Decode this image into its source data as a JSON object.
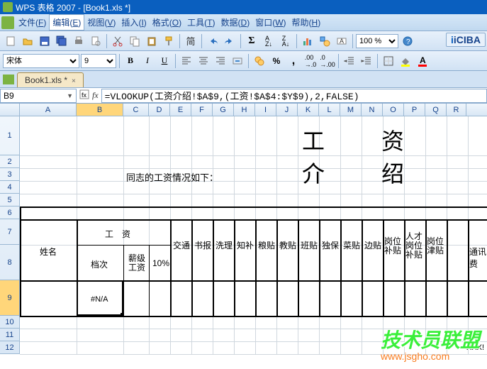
{
  "title": "WPS 表格 2007 - [Book1.xls *]",
  "menu": {
    "file": "文件",
    "fk": "F",
    "edit": "编辑",
    "ek": "E",
    "view": "视图",
    "vk": "V",
    "insert": "插入",
    "ik": "I",
    "format": "格式",
    "ok": "O",
    "tools": "工具",
    "tk": "T",
    "data": "数据",
    "dk": "D",
    "window": "窗口",
    "wk": "W",
    "help": "帮助",
    "hk": "H"
  },
  "fontname": "宋体",
  "fontsize": "9",
  "zoom": "100 %",
  "cjk": "简",
  "iciba": "iCIBA",
  "tab": {
    "name": "Book1.xls *",
    "close": "×"
  },
  "namebox": "B9",
  "formula": "=VLOOKUP(工资介绍!$A$9,(工资!$A$4:$Y$9),2,FALSE)",
  "cols": [
    "A",
    "B",
    "C",
    "D",
    "E",
    "F",
    "G",
    "H",
    "I",
    "J",
    "K",
    "L",
    "M",
    "N",
    "O",
    "P",
    "Q",
    "R"
  ],
  "rows": [
    "1",
    "2",
    "3",
    "4",
    "5",
    "6",
    "7",
    "8",
    "9",
    "10",
    "11",
    "12"
  ],
  "content": {
    "title": "工　资　介　绍",
    "intro": "同志的工资情况如下：",
    "h_name": "姓名",
    "h_salary": "工　资",
    "h_level": "档次",
    "h_pay": "薪级工资",
    "h_10": "10%",
    "h_c5": "交通",
    "h_c6": "书报",
    "h_c7": "洗理",
    "h_c8": "知补",
    "h_c9": "粮贴",
    "h_c10": "教贴",
    "h_c11": "班贴",
    "h_c12": "独保",
    "h_c13": "菜贴",
    "h_c14": "边贴",
    "h_c15": "岗位补贴",
    "h_c16": "人才岗位补贴",
    "h_c17": "岗位津贴",
    "h_c18": "通讯费",
    "b9": "#N/A",
    "r12": "XXX!"
  },
  "watermark": {
    "line1": "技术员联盟",
    "line2": "www.jsgho.com"
  }
}
